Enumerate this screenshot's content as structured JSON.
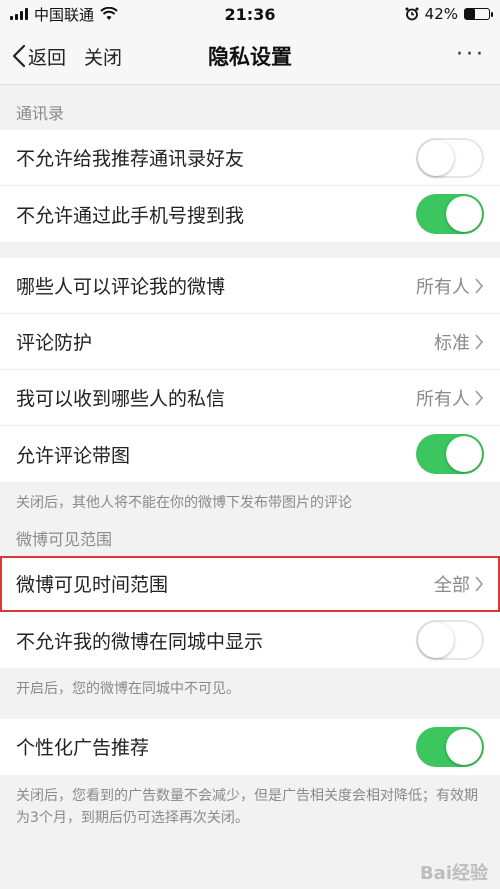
{
  "status": {
    "carrier": "中国联通",
    "time": "21:36",
    "battery_percent": "42%",
    "battery_level": 0.42
  },
  "nav": {
    "back_label": "返回",
    "close_label": "关闭",
    "title": "隐私设置",
    "more_label": "···"
  },
  "sections": {
    "contacts_label": "通讯录",
    "visibility_label": "微博可见范围"
  },
  "contacts": {
    "no_recommend": {
      "label": "不允许给我推荐通讯录好友",
      "on": false
    },
    "no_search_by_phone": {
      "label": "不允许通过此手机号搜到我",
      "on": true
    }
  },
  "comments": {
    "who_can_comment": {
      "label": "哪些人可以评论我的微博",
      "value": "所有人"
    },
    "comment_protection": {
      "label": "评论防护",
      "value": "标准"
    },
    "private_messages": {
      "label": "我可以收到哪些人的私信",
      "value": "所有人"
    },
    "allow_image_comments": {
      "label": "允许评论带图",
      "on": true
    },
    "image_comment_note": "关闭后，其他人将不能在你的微博下发布带图片的评论"
  },
  "visibility": {
    "time_range": {
      "label": "微博可见时间范围",
      "value": "全部"
    },
    "hide_same_city": {
      "label": "不允许我的微博在同城中显示",
      "on": false
    },
    "same_city_note": "开启后，您的微博在同城中不可见。"
  },
  "ads": {
    "personalized": {
      "label": "个性化广告推荐",
      "on": true
    },
    "note": "关闭后，您看到的广告数量不会减少，但是广告相关度会相对降低；有效期为3个月，到期后仍可选择再次关闭。"
  },
  "colors": {
    "toggle_on": "#3cc65f",
    "highlight_border": "#d93a32"
  },
  "watermark": "Bai经验"
}
